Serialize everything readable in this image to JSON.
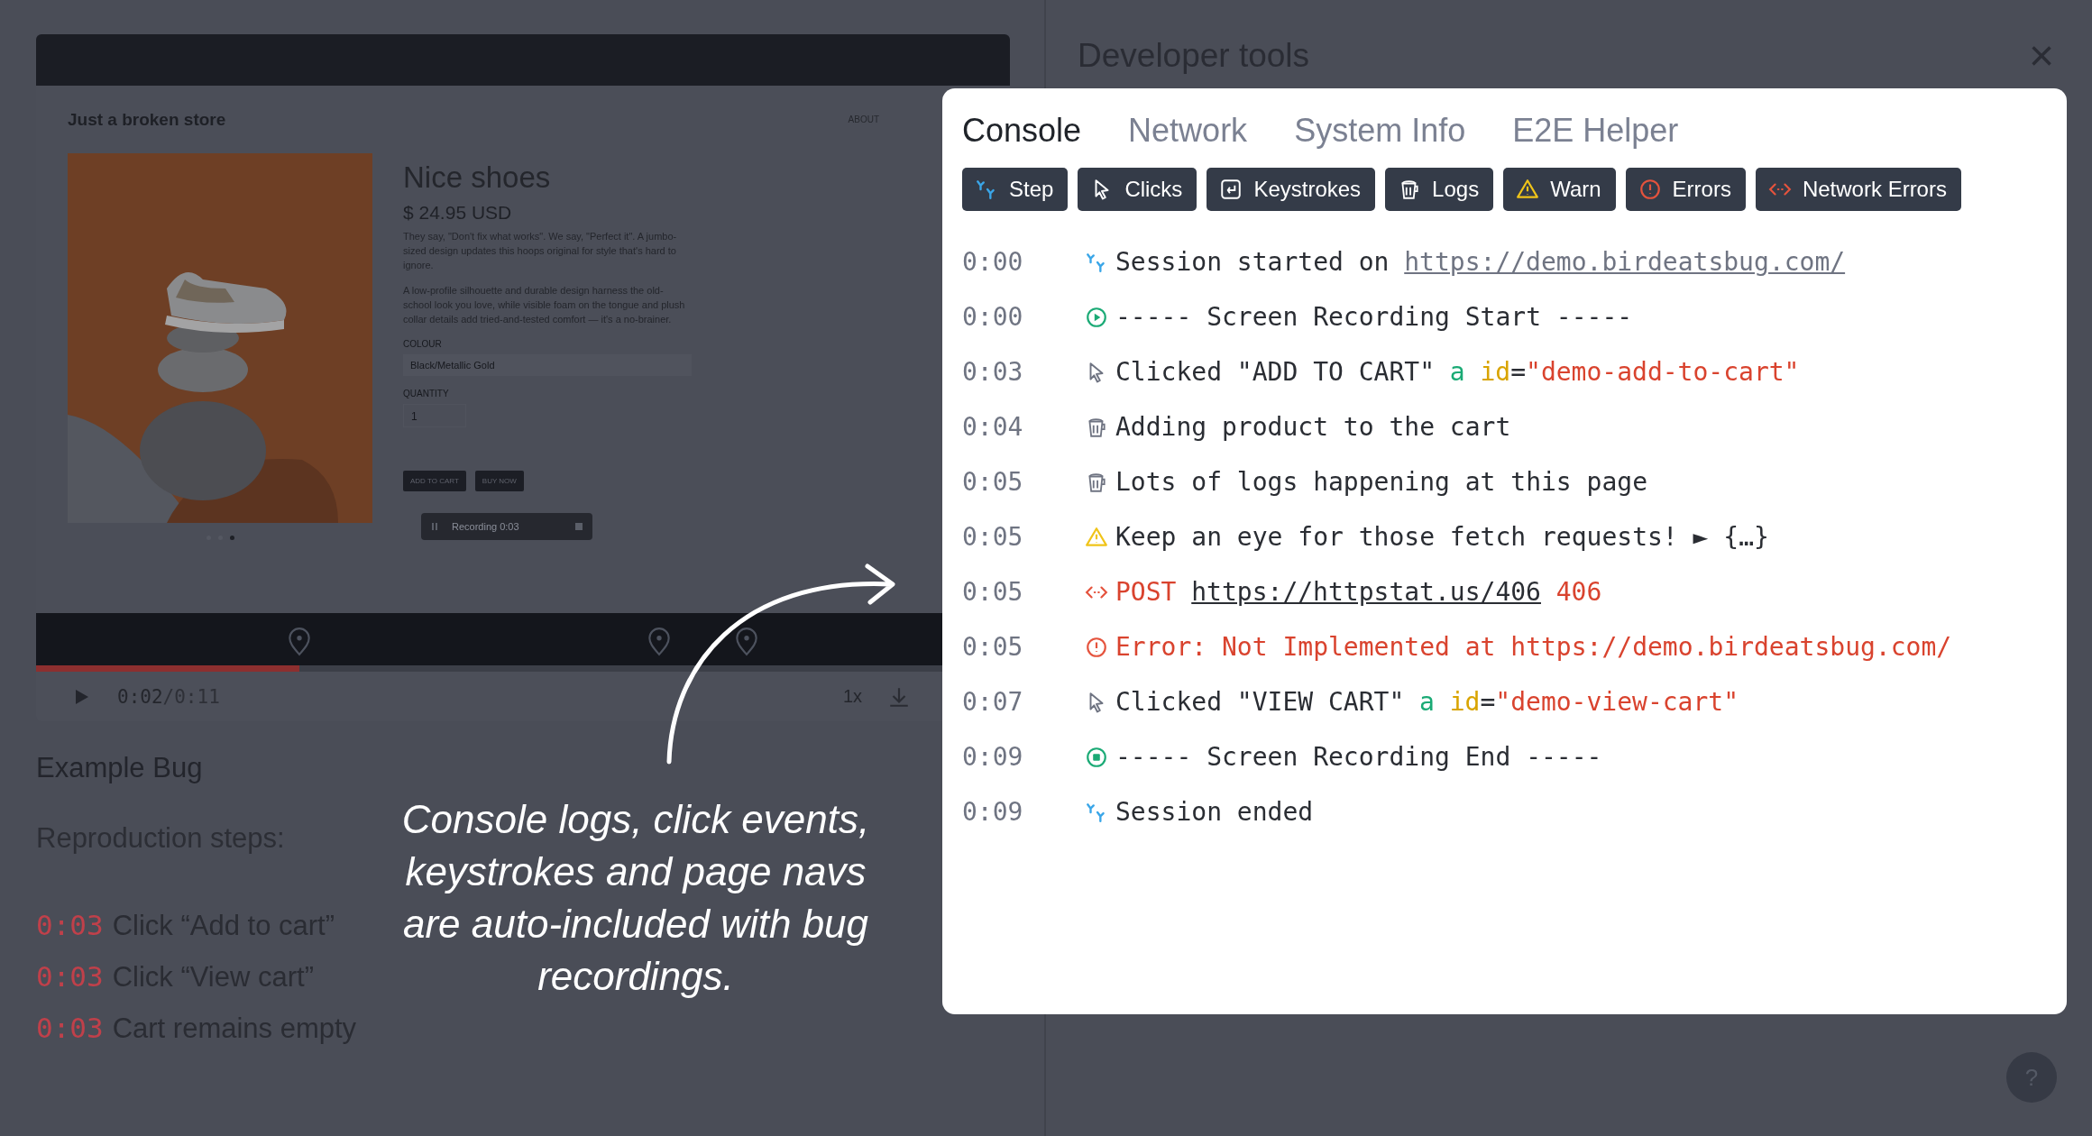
{
  "video": {
    "store": {
      "logo": "Just a broken store",
      "nav": "ABOUT",
      "product": "Nice shoes",
      "price": "$ 24.95 USD",
      "description": [
        "They say, \"Don't fix what works\". We say, \"Perfect it\". A jumbo-sized design updates this hoops original for style that's hard to ignore.",
        "A low-profile silhouette and durable design harness the old-school look you love, while visible foam on the tongue and plush collar details add tried-and-tested comfort — it's a no-brainer."
      ],
      "colour_label": "COLOUR",
      "colour_value": "Black/Metallic Gold",
      "quantity_label": "QUANTITY",
      "quantity": "1",
      "buttons": [
        "ADD TO CART",
        "BUY NOW"
      ],
      "carousel": [
        {
          "selected": false
        },
        {
          "selected": false
        },
        {
          "selected": true
        }
      ]
    },
    "recorder": {
      "label": "Recording 0:03"
    },
    "progress": {
      "level": 0.27
    },
    "time_current": "0:02",
    "time_total": "/0:11",
    "speed": "1x"
  },
  "bug": {
    "title": "Example Bug",
    "steps_heading": "Reproduction steps:",
    "steps": [
      {
        "time": "0:03",
        "text": "Click “Add to cart”"
      },
      {
        "time": "0:03",
        "text": "Click “View cart”"
      },
      {
        "time": "0:03",
        "text": "Cart remains empty"
      }
    ]
  },
  "annotation": "Console logs, click events,\nkeystrokes and page navs\nare auto-included with bug\nrecordings.",
  "devtools": {
    "title": "Developer tools",
    "close": "×",
    "tabs": [
      {
        "label": "Console",
        "selected": true
      },
      {
        "label": "Network",
        "selected": false
      },
      {
        "label": "System Info",
        "selected": false
      },
      {
        "label": "E2E Helper",
        "selected": false
      }
    ],
    "filters": [
      {
        "label": "Step",
        "kind": "step"
      },
      {
        "label": "Clicks",
        "kind": "click"
      },
      {
        "label": "Keystrokes",
        "kind": "keystroke"
      },
      {
        "label": "Logs",
        "kind": "log"
      },
      {
        "label": "Warn",
        "kind": "warn"
      },
      {
        "label": "Errors",
        "kind": "error"
      },
      {
        "label": "Network Errors",
        "kind": "network"
      }
    ],
    "logs": [
      {
        "time": "0:00",
        "kind": "step",
        "text": "Session started on",
        "url": "https://demo.birdeatsbug.com/"
      },
      {
        "time": "0:00",
        "kind": "rec-start",
        "text": "----- Screen Recording Start -----"
      },
      {
        "time": "0:03",
        "kind": "click",
        "text": "Clicked \"ADD TO CART\"",
        "tag": "a",
        "attr": "id",
        "sign": "=",
        "value": "\"demo-add-to-cart\""
      },
      {
        "time": "0:04",
        "kind": "log",
        "text": "Adding product to the cart"
      },
      {
        "time": "0:05",
        "kind": "log",
        "text": "Lots of logs happening at this page"
      },
      {
        "time": "0:05",
        "kind": "warn",
        "text": "Keep an eye for those fetch requests! ► {…}"
      },
      {
        "time": "0:05",
        "kind": "network",
        "method": "POST",
        "url": "https://httpstat.us/406",
        "status": "406"
      },
      {
        "time": "0:05",
        "kind": "error",
        "text": "Error: Not Implemented at https://demo.birdeatsbug.com/"
      },
      {
        "time": "0:07",
        "kind": "click",
        "text": "Clicked \"VIEW CART\"",
        "tag": "a",
        "attr": "id",
        "sign": "=",
        "value": "\"demo-view-cart\""
      },
      {
        "time": "0:09",
        "kind": "rec-end",
        "text": "----- Screen Recording End -----"
      },
      {
        "time": "0:09",
        "kind": "step",
        "text": "Session ended"
      }
    ]
  },
  "help": "?"
}
